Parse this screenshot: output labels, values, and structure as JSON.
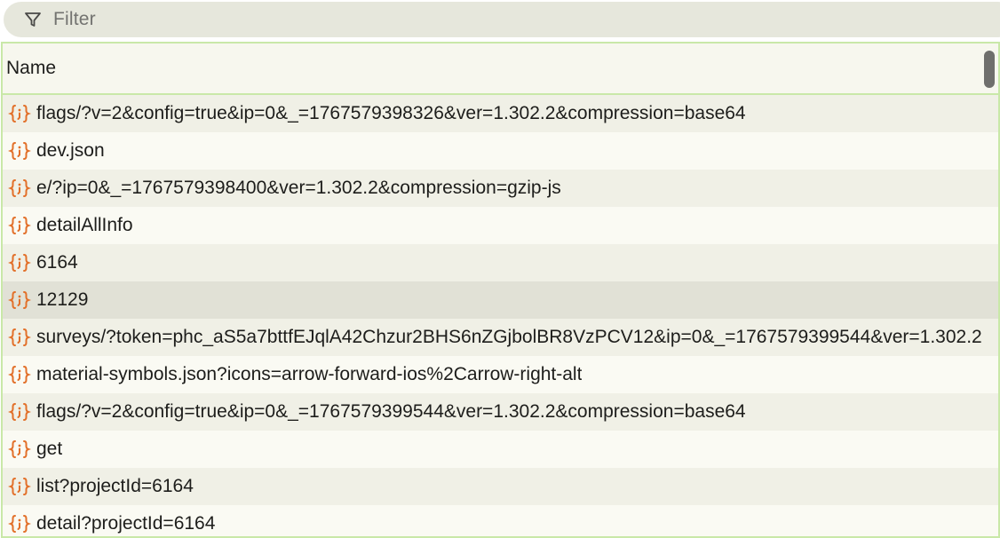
{
  "filter": {
    "label": "Filter",
    "icon": "filter-icon"
  },
  "table": {
    "column_header": "Name",
    "row_icon": "json-braces-icon",
    "icon_color": "#e2702a",
    "rows": [
      {
        "name": "flags/?v=2&config=true&ip=0&_=1767579398326&ver=1.302.2&compression=base64"
      },
      {
        "name": "dev.json"
      },
      {
        "name": "e/?ip=0&_=1767579398400&ver=1.302.2&compression=gzip-js"
      },
      {
        "name": "detailAllInfo"
      },
      {
        "name": "6164"
      },
      {
        "name": "12129",
        "selected": true
      },
      {
        "name": "surveys/?token=phc_aS5a7bttfEJqlA42Chzur2BHS6nZGjbolBR8VzPCV12&ip=0&_=1767579399544&ver=1.302.2"
      },
      {
        "name": "material-symbols.json?icons=arrow-forward-ios%2Carrow-right-alt"
      },
      {
        "name": "flags/?v=2&config=true&ip=0&_=1767579399544&ver=1.302.2&compression=base64"
      },
      {
        "name": "get"
      },
      {
        "name": "list?projectId=6164"
      },
      {
        "name": "detail?projectId=6164"
      }
    ]
  }
}
